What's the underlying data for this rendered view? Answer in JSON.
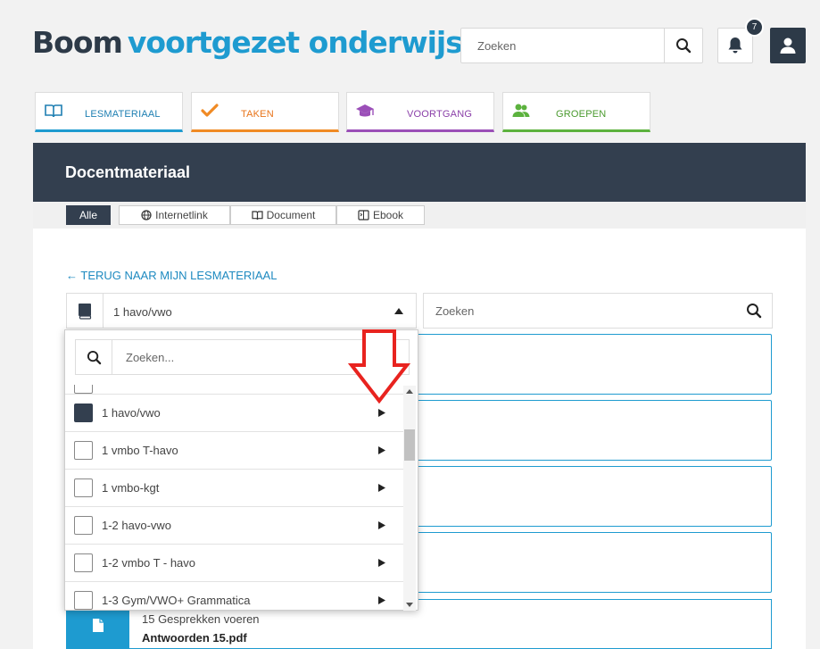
{
  "header": {
    "logo_part1": "Boom",
    "logo_part2": "voortgezet onderwijs",
    "search_placeholder": "Zoeken",
    "notification_count": "7"
  },
  "tabs": [
    {
      "label": "LESMATERIAAL",
      "icon": "book-icon",
      "color": "#1e9bd0"
    },
    {
      "label": "TAKEN",
      "icon": "check-icon",
      "color": "#f08a24"
    },
    {
      "label": "VOORTGANG",
      "icon": "graduation-cap-icon",
      "color": "#9b4fb8"
    },
    {
      "label": "GROEPEN",
      "icon": "group-icon",
      "color": "#5cb23e"
    }
  ],
  "page_title": "Docentmateriaal",
  "filters": [
    {
      "label": "Alle",
      "icon": ""
    },
    {
      "label": "Internetlink",
      "icon": "globe-icon"
    },
    {
      "label": "Document",
      "icon": "book-icon"
    },
    {
      "label": "Ebook",
      "icon": "ebook-icon"
    }
  ],
  "back_link": "← TERUG NAAR MIJN LESMATERIAAL",
  "method_selector": {
    "value": "1 havo/vwo"
  },
  "material_search_placeholder": "Zoeken",
  "dropdown": {
    "search_placeholder": "Zoeken...",
    "items": [
      {
        "label": "1 havo/vwo",
        "checked": true
      },
      {
        "label": "1 vmbo T-havo",
        "checked": false
      },
      {
        "label": "1 vmbo-kgt",
        "checked": false
      },
      {
        "label": "1-2 havo-vwo",
        "checked": false
      },
      {
        "label": "1-2 vmbo T - havo",
        "checked": false
      },
      {
        "label": "1-3 Gym/VWO+ Grammatica",
        "checked": false
      }
    ]
  },
  "file_item": {
    "chapter": "15 Gesprekken voeren",
    "name": "Antwoorden 15.pdf"
  },
  "colors": {
    "accent": "#1e9bd0",
    "dark": "#333f4f",
    "annotation": "#e8231f"
  }
}
